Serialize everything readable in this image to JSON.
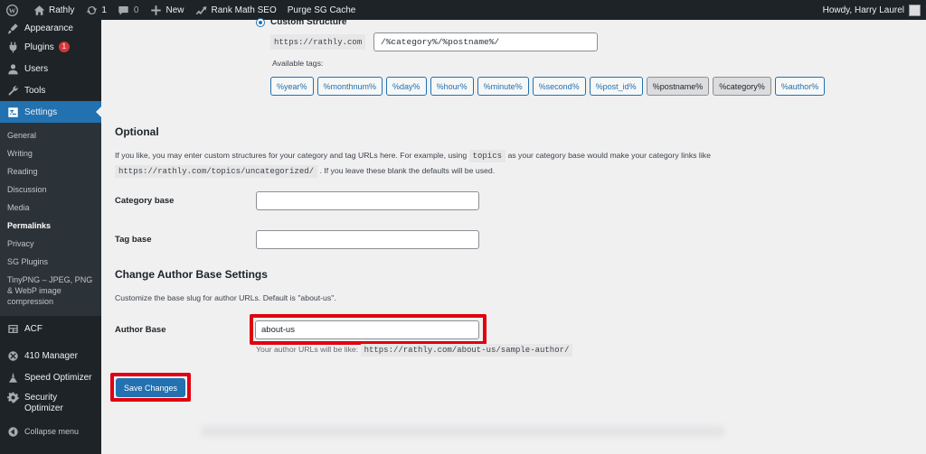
{
  "adminbar": {
    "site_name": "Rathly",
    "updates_count": "1",
    "comments_count": "0",
    "new_label": "New",
    "rankmath_label": "Rank Math SEO",
    "purge_label": "Purge SG Cache",
    "howdy": "Howdy, Harry Laurel"
  },
  "sidebar": {
    "appearance": "Appearance",
    "plugins": "Plugins",
    "plugins_badge": "1",
    "users": "Users",
    "tools": "Tools",
    "settings": "Settings",
    "submenu": [
      "General",
      "Writing",
      "Reading",
      "Discussion",
      "Media",
      "Permalinks",
      "Privacy",
      "SG Plugins",
      "TinyPNG – JPEG, PNG & WebP image compression"
    ],
    "acf": "ACF",
    "manager410": "410 Manager",
    "speed_optimizer": "Speed Optimizer",
    "security_optimizer": "Security Optimizer",
    "collapse": "Collapse menu"
  },
  "custom_structure": {
    "label": "Custom Structure",
    "prefix": "https://rathly.com",
    "value": "/%category%/%postname%/",
    "available_tags_label": "Available tags:",
    "tags": [
      "%year%",
      "%monthnum%",
      "%day%",
      "%hour%",
      "%minute%",
      "%second%",
      "%post_id%",
      "%postname%",
      "%category%",
      "%author%"
    ]
  },
  "optional": {
    "heading": "Optional",
    "desc_part1": "If you like, you may enter custom structures for your category and tag URLs here. For example, using",
    "desc_code1": "topics",
    "desc_part2": "as your category base would make your category links like",
    "desc_code2": "https://rathly.com/topics/uncategorized/",
    "desc_part3": ". If you leave these blank the defaults will be used.",
    "category_base_label": "Category base",
    "tag_base_label": "Tag base"
  },
  "author_base": {
    "heading": "Change Author Base Settings",
    "desc": "Customize the base slug for author URLs. Default is \"about-us\".",
    "label": "Author Base",
    "value": "about-us",
    "hint": "Your author URLs will be like:",
    "hint_code": "https://rathly.com/about-us/sample-author/"
  },
  "save_button": "Save Changes"
}
